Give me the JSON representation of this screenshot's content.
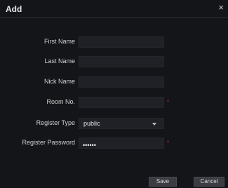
{
  "dialog": {
    "title": "Add",
    "close_glyph": "×"
  },
  "form": {
    "first_name": {
      "label": "First Name",
      "value": ""
    },
    "last_name": {
      "label": "Last Name",
      "value": ""
    },
    "nick_name": {
      "label": "Nick Name",
      "value": ""
    },
    "room_no": {
      "label": "Room No.",
      "value": "",
      "required_mark": "*"
    },
    "register_type": {
      "label": "Register Type",
      "selected": "public"
    },
    "register_password": {
      "label": "Register Password",
      "value": "••••••",
      "required_mark": "*"
    }
  },
  "buttons": {
    "save_label": "Save",
    "cancel_label": "Cancel"
  },
  "colors": {
    "background": "#141518",
    "field_background": "#202127",
    "required_mark": "#b3262e",
    "button_background": "#3b3c42"
  },
  "icons": {
    "close": "close-icon",
    "dropdown": "chevron-down-icon"
  }
}
